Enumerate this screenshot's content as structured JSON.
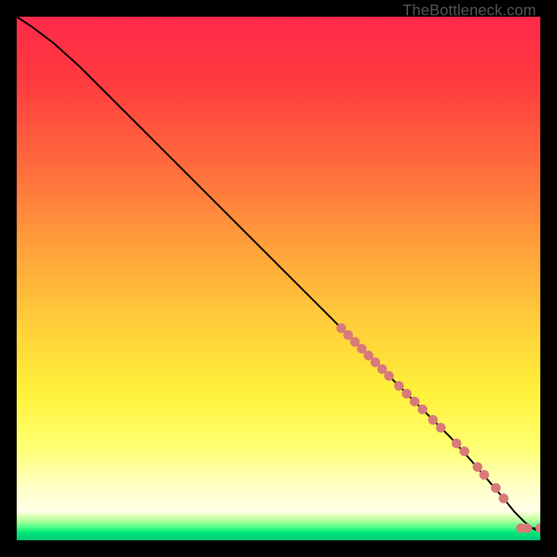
{
  "watermark": "TheBottleneck.com",
  "chart_data": {
    "type": "line",
    "title": "",
    "xlabel": "",
    "ylabel": "",
    "xlim": [
      0,
      100
    ],
    "ylim": [
      0,
      100
    ],
    "grid": false,
    "legend": false,
    "gradient_stops": [
      {
        "offset": 0.0,
        "color": "#ff2a4a"
      },
      {
        "offset": 0.12,
        "color": "#ff3a3f"
      },
      {
        "offset": 0.3,
        "color": "#ff703d"
      },
      {
        "offset": 0.45,
        "color": "#ffa43a"
      },
      {
        "offset": 0.6,
        "color": "#ffd23a"
      },
      {
        "offset": 0.72,
        "color": "#fff23a"
      },
      {
        "offset": 0.82,
        "color": "#ffff70"
      },
      {
        "offset": 0.9,
        "color": "#ffffc8"
      },
      {
        "offset": 0.945,
        "color": "#ffffe8"
      },
      {
        "offset": 0.955,
        "color": "#d8ffb0"
      },
      {
        "offset": 0.965,
        "color": "#9fff9a"
      },
      {
        "offset": 0.975,
        "color": "#4fff8a"
      },
      {
        "offset": 0.985,
        "color": "#00e878"
      },
      {
        "offset": 1.0,
        "color": "#00c87a"
      }
    ],
    "series": [
      {
        "name": "curve",
        "color": "#000000",
        "x": [
          0,
          3,
          7,
          12,
          20,
          30,
          40,
          50,
          60,
          66,
          72,
          78,
          83,
          87,
          90,
          93,
          95,
          97,
          98.5,
          100
        ],
        "y": [
          100,
          98,
          95,
          90.5,
          82.5,
          72.5,
          62.5,
          52.5,
          42.5,
          36.5,
          30.5,
          24.5,
          19.5,
          15,
          11.5,
          8,
          5.5,
          3.5,
          2.3,
          1.5
        ]
      }
    ],
    "dots": {
      "color": "#d87a7a",
      "radius": 7,
      "points": [
        {
          "x": 62.0,
          "y": 40.5
        },
        {
          "x": 63.3,
          "y": 39.2
        },
        {
          "x": 64.6,
          "y": 37.9
        },
        {
          "x": 65.9,
          "y": 36.6
        },
        {
          "x": 67.2,
          "y": 35.3
        },
        {
          "x": 68.5,
          "y": 34.0
        },
        {
          "x": 69.8,
          "y": 32.7
        },
        {
          "x": 71.1,
          "y": 31.4
        },
        {
          "x": 73.0,
          "y": 29.5
        },
        {
          "x": 74.5,
          "y": 28.0
        },
        {
          "x": 76.0,
          "y": 26.5
        },
        {
          "x": 77.5,
          "y": 25.0
        },
        {
          "x": 79.5,
          "y": 23.0
        },
        {
          "x": 81.0,
          "y": 21.5
        },
        {
          "x": 84.0,
          "y": 18.5
        },
        {
          "x": 85.5,
          "y": 17.0
        },
        {
          "x": 88.0,
          "y": 14.0
        },
        {
          "x": 89.3,
          "y": 12.5
        },
        {
          "x": 91.5,
          "y": 10.0
        },
        {
          "x": 93.0,
          "y": 8.0
        },
        {
          "x": 96.3,
          "y": 2.3
        },
        {
          "x": 97.5,
          "y": 2.3
        },
        {
          "x": 100.0,
          "y": 2.3
        }
      ]
    }
  }
}
